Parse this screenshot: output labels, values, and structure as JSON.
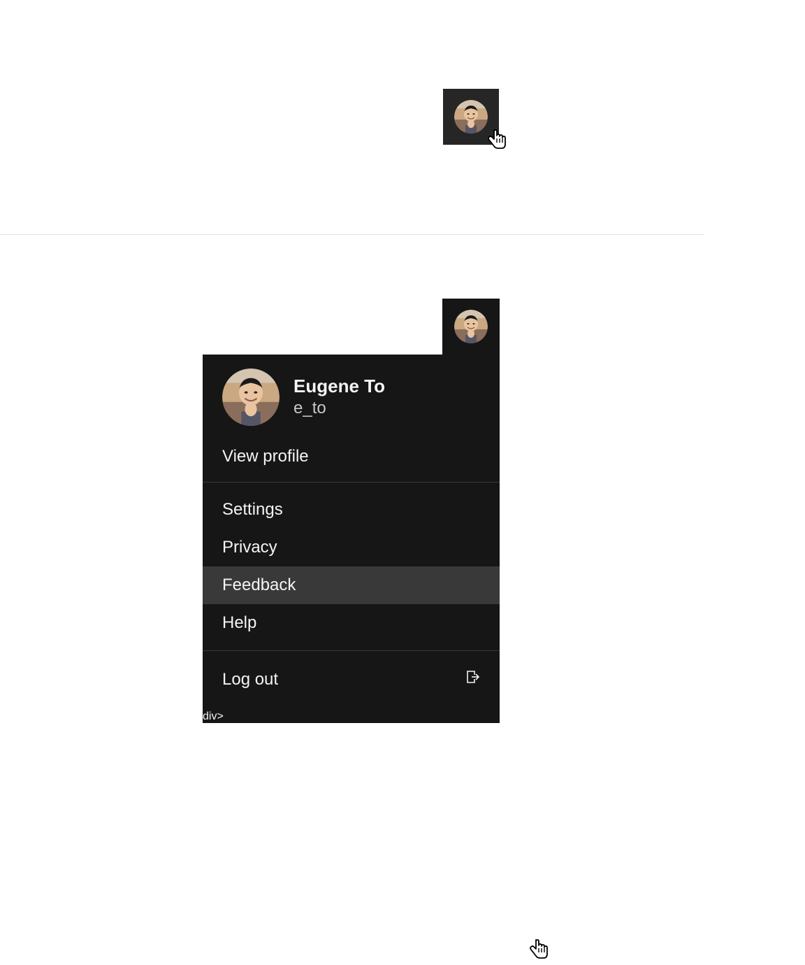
{
  "user": {
    "name": "Eugene To",
    "handle": "e_to"
  },
  "menu": {
    "view_profile": "View profile",
    "settings": "Settings",
    "privacy": "Privacy",
    "feedback": "Feedback",
    "help": "Help",
    "logout": "Log out"
  }
}
